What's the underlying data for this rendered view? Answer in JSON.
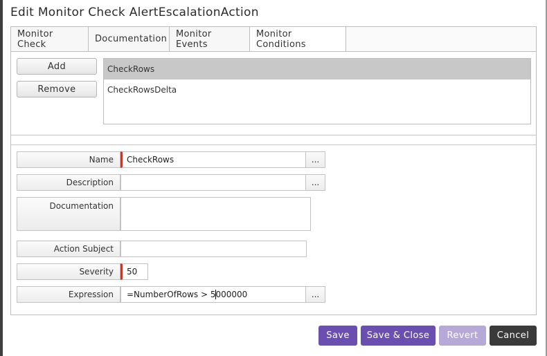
{
  "dialog": {
    "title": "Edit Monitor Check AlertEscalationAction"
  },
  "tabs": [
    {
      "label": "Monitor Check"
    },
    {
      "label": "Documentation"
    },
    {
      "label": "Monitor Events"
    },
    {
      "label": "Monitor Conditions",
      "active": true
    }
  ],
  "conditions": {
    "add_label": "Add",
    "remove_label": "Remove",
    "items": [
      {
        "label": "CheckRows",
        "selected": true
      },
      {
        "label": "CheckRowsDelta",
        "selected": false
      }
    ]
  },
  "form": {
    "name": {
      "label": "Name",
      "value": "CheckRows",
      "required": true
    },
    "description": {
      "label": "Description",
      "value": ""
    },
    "documentation": {
      "label": "Documentation",
      "value": ""
    },
    "action_subject": {
      "label": "Action Subject",
      "value": ""
    },
    "severity": {
      "label": "Severity",
      "value": "50",
      "required": true
    },
    "expression": {
      "label": "Expression",
      "value_before_caret": "=NumberOfRows > 5",
      "value_after_caret": "000000"
    },
    "ellipsis": "..."
  },
  "footer": {
    "save_label": "Save",
    "save_close_label": "Save & Close",
    "revert_label": "Revert",
    "cancel_label": "Cancel"
  },
  "colors": {
    "primary": "#6a4fb1",
    "disabled": "#b6a9d8",
    "cancel": "#3a3a3a",
    "required": "#c0392b"
  }
}
